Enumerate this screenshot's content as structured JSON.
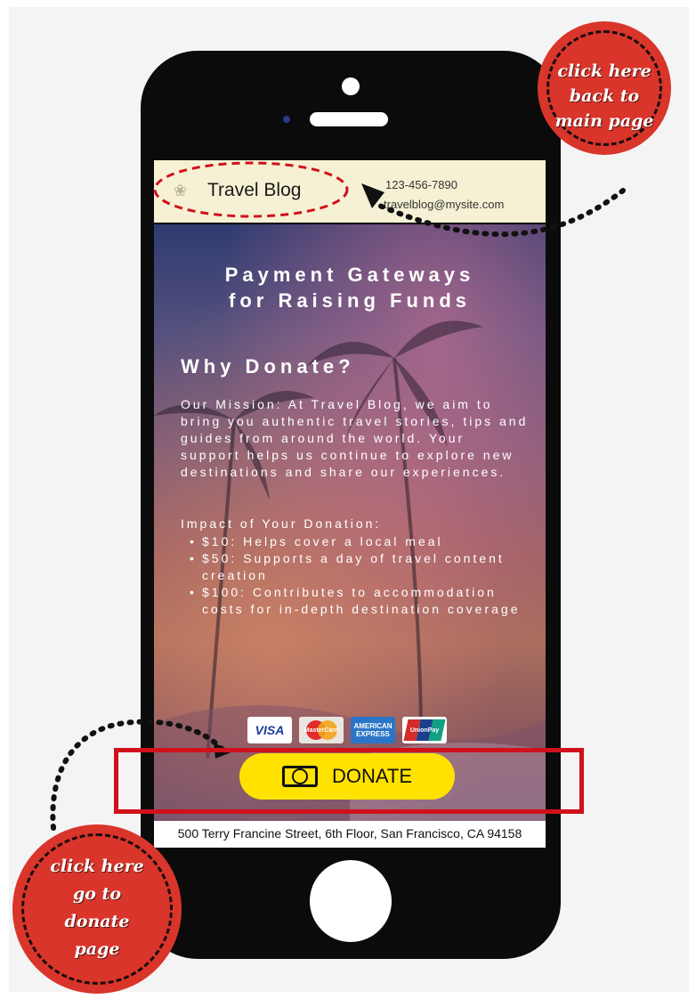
{
  "site": {
    "brand": "Travel Blog",
    "phone": "123-456-7890",
    "email": "travelblog@mysite.com",
    "logo_icon": "flower-icon"
  },
  "hero": {
    "title_line1": "Payment Gateways",
    "title_line2": "for Raising Funds",
    "why_heading": "Why Donate?",
    "mission": "Our Mission: At Travel Blog, we aim to bring you authentic travel stories, tips and guides from around the world. Your support helps us continue to explore new destinations and share our experiences.",
    "impact_heading": "Impact of Your Donation:",
    "impact_items": [
      "$10: Helps cover a local meal",
      "$50: Supports a day of travel content creation",
      "$100: Contributes to accommodation costs for in-depth destination coverage"
    ]
  },
  "payment_cards": {
    "visa": "VISA",
    "mastercard": "MasterCard",
    "amex": "AMERICAN EXPRESS",
    "unionpay": "UnionPay"
  },
  "donate_button": {
    "label": "DONATE",
    "icon": "cash-bill-icon"
  },
  "footer": {
    "address": "500 Terry Francine Street, 6th Floor, San Francisco, CA 94158"
  },
  "annotations": {
    "back_badge": [
      "click here",
      "back to",
      "main page"
    ],
    "donate_badge": [
      "click here",
      "go to",
      "donate",
      "page"
    ]
  },
  "colors": {
    "header_bg": "#f6f1d4",
    "button_yellow": "#ffe200",
    "annotation_red": "#d9352b",
    "highlight_red": "#d0111b"
  }
}
